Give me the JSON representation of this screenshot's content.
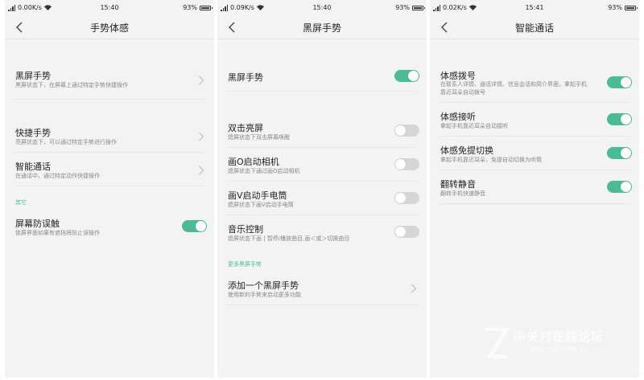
{
  "colors": {
    "accent": "#4bbb97",
    "background": "#f3f3f3"
  },
  "screens": [
    {
      "status": {
        "speed": "0.00K/s",
        "time": "15:40",
        "battery": "93%"
      },
      "title": "手势体感",
      "items": [
        {
          "title": "黑屏手势",
          "subtitle": "黑屏状态下，在屏幕上通过特定手势快捷操作"
        },
        {
          "title": "快捷手势",
          "subtitle": "亮屏状态下，可以通过特定手势进行操作"
        },
        {
          "title": "智能通话",
          "subtitle": "在通话中，通过特定动作快捷操作"
        }
      ],
      "section": "其它",
      "toggle_item": {
        "title": "屏幕防误触",
        "subtitle": "锁屏界面如果有遮挡将防止误操作",
        "on": true
      }
    },
    {
      "status": {
        "speed": "0.09K/s",
        "time": "15:40",
        "battery": "93%"
      },
      "title": "黑屏手势",
      "master": {
        "title": "黑屏手势",
        "on": true
      },
      "items": [
        {
          "title": "双击亮屏",
          "subtitle": "熄屏状态下双击屏幕唤醒",
          "on": false
        },
        {
          "title": "画O启动相机",
          "subtitle": "熄屏状态下通过画O启动相机",
          "on": false
        },
        {
          "title": "画V启动手电筒",
          "subtitle": "熄屏状态下画V启动手电筒",
          "on": false
        },
        {
          "title": "音乐控制",
          "subtitle": "熄屏状态下画 | 暂停/播放曲目,画＜或＞切换曲目",
          "on": false
        }
      ],
      "section": "更多黑屏手势",
      "add_item": {
        "title": "添加一个黑屏手势",
        "subtitle": "使用新的手势来启动更多功能"
      }
    },
    {
      "status": {
        "speed": "0.02K/s",
        "time": "15:41",
        "battery": "93%"
      },
      "title": "智能通话",
      "items": [
        {
          "title": "体感拨号",
          "subtitle": "在联系人详情、通话详情、信息会话和简介界面，拿起手机靠近耳朵自动拨号",
          "on": true
        },
        {
          "title": "体感接听",
          "subtitle": "拿起手机靠近耳朵自动接听",
          "on": true
        },
        {
          "title": "体感免提切换",
          "subtitle": "拿起手机靠近耳朵，免提自动切换为听筒",
          "on": true
        },
        {
          "title": "翻转静音",
          "subtitle": "翻转手机快速静音",
          "on": true
        }
      ]
    }
  ],
  "watermark": {
    "text": "中关村在线论坛",
    "url": "bbs.zol.com.cn"
  }
}
